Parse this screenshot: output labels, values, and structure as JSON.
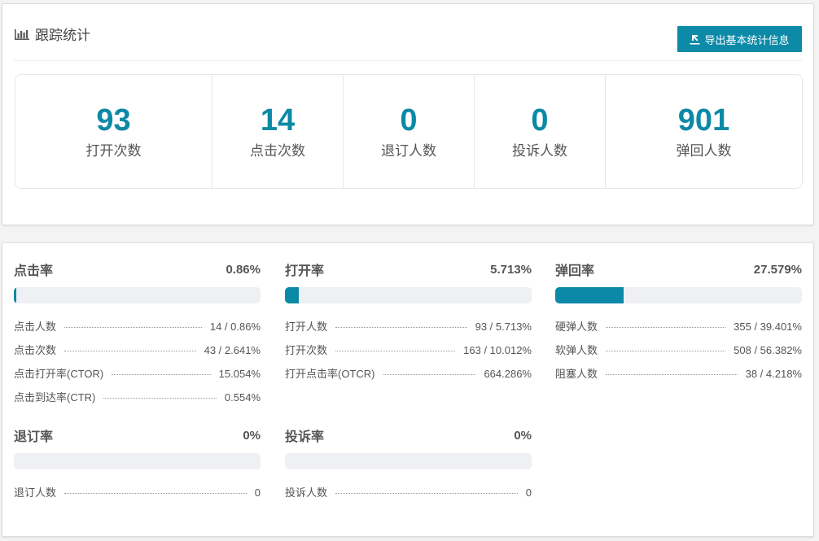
{
  "header": {
    "title": "跟踪统计",
    "export_label": "导出基本统计信息"
  },
  "stats": [
    {
      "value": "93",
      "label": "打开次数"
    },
    {
      "value": "14",
      "label": "点击次数"
    },
    {
      "value": "0",
      "label": "退订人数"
    },
    {
      "value": "0",
      "label": "投诉人数"
    },
    {
      "value": "901",
      "label": "弹回人数"
    }
  ],
  "metrics": {
    "click": {
      "title": "点击率",
      "percent": "0.86%",
      "fill": 0.0086,
      "rows": [
        {
          "label": "点击人数",
          "value": "14 / 0.86%"
        },
        {
          "label": "点击次数",
          "value": "43 / 2.641%"
        },
        {
          "label": "点击打开率(CTOR)",
          "value": "15.054%"
        },
        {
          "label": "点击到达率(CTR)",
          "value": "0.554%"
        }
      ]
    },
    "open": {
      "title": "打开率",
      "percent": "5.713%",
      "fill": 0.05713,
      "rows": [
        {
          "label": "打开人数",
          "value": "93 / 5.713%"
        },
        {
          "label": "打开次数",
          "value": "163 / 10.012%"
        },
        {
          "label": "打开点击率(OTCR)",
          "value": "664.286%"
        }
      ]
    },
    "bounce": {
      "title": "弹回率",
      "percent": "27.579%",
      "fill": 0.27579,
      "rows": [
        {
          "label": "硬弹人数",
          "value": "355 / 39.401%"
        },
        {
          "label": "软弹人数",
          "value": "508 / 56.382%"
        },
        {
          "label": "阻塞人数",
          "value": "38 / 4.218%"
        }
      ]
    },
    "unsubscribe": {
      "title": "退订率",
      "percent": "0%",
      "fill": 0,
      "rows": [
        {
          "label": "退订人数",
          "value": "0"
        }
      ]
    },
    "complaint": {
      "title": "投诉率",
      "percent": "0%",
      "fill": 0,
      "rows": [
        {
          "label": "投诉人数",
          "value": "0"
        }
      ]
    }
  },
  "colors": {
    "accent": "#0c89a6",
    "bar_bg": "#eef0f3"
  }
}
